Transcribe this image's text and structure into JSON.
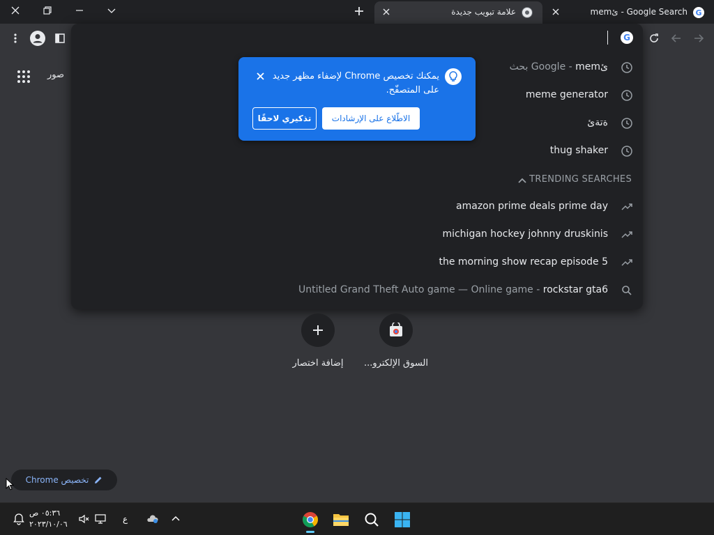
{
  "tabs": [
    {
      "title": "علامة تبويب جديدة",
      "active": true
    },
    {
      "title": "memئ - Google Search",
      "active": false
    }
  ],
  "toolbar": {
    "omnibox_text": ""
  },
  "omnibox": {
    "suggestions": [
      {
        "text": "memئ",
        "sub": "بحث Google - ",
        "icon": "history-icon"
      },
      {
        "text": "meme generator",
        "sub": "",
        "icon": "history-icon"
      },
      {
        "text": "ةتةئ",
        "sub": "",
        "icon": "history-icon"
      },
      {
        "text": "thug shaker",
        "sub": "",
        "icon": "history-icon"
      }
    ],
    "trending_header": "TRENDING SEARCHES",
    "trending": [
      {
        "text": "amazon prime deals prime day",
        "icon": "trending-icon"
      },
      {
        "text": "michigan hockey johnny druskinis",
        "icon": "trending-icon"
      },
      {
        "text": "the morning show recap episode 5",
        "icon": "trending-icon"
      }
    ],
    "entity": {
      "text": "rockstar gta6",
      "sub": "Untitled Grand Theft Auto game — Online game - ",
      "icon": "search-icon"
    }
  },
  "page": {
    "images_link": "صور"
  },
  "promo": {
    "text": "يمكنك تخصيص Chrome لإضفاء مظهر جديد على المتصفّح.",
    "primary_button": "الاطّلاع على الإرشادات",
    "secondary_button": "تذكيري لاحقًا"
  },
  "shortcuts": [
    {
      "label": "السوق الإلكترو..."
    },
    {
      "label": "إضافة اختصار"
    }
  ],
  "customize_chip": "تخصيص Chrome",
  "taskbar": {
    "time": "٠٥:٣٦ ص",
    "date": "٢٠٢٣/١٠/٠٦",
    "lang": "ع",
    "accent": "#60cdff"
  }
}
